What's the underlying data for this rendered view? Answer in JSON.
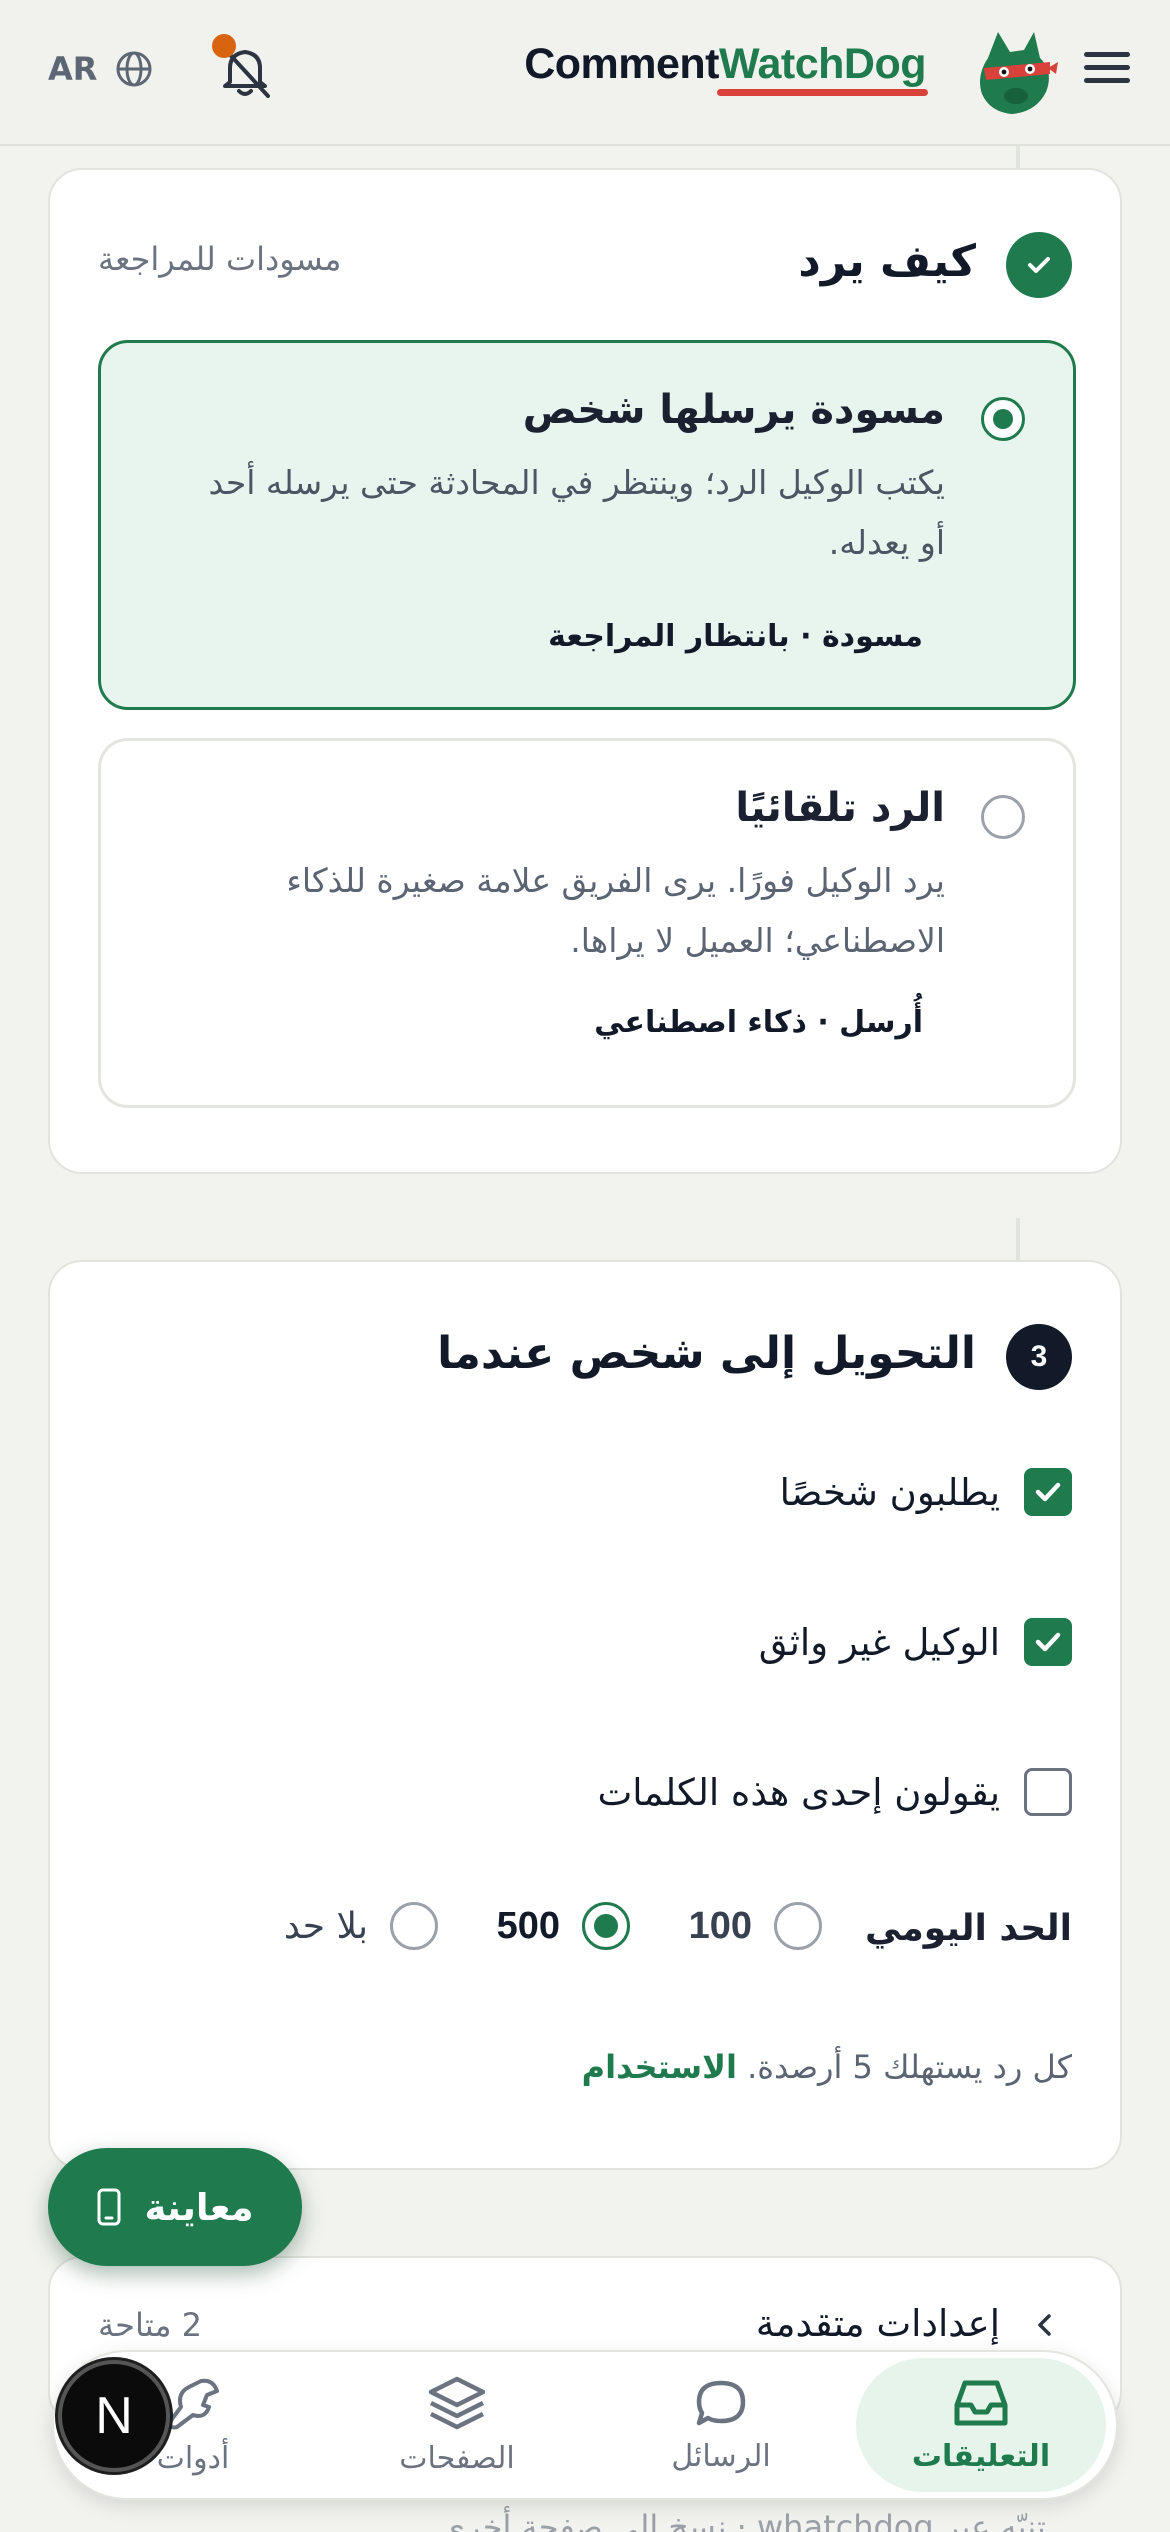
{
  "header": {
    "brand_part1": "Comment",
    "brand_part2": "WatchDog",
    "lang_label": "AR",
    "notification_dot_color": "#d9640f",
    "menu_icon": "hamburger-icon",
    "lang_icon": "globe-icon",
    "bell_icon": "bell-off-icon"
  },
  "section_reply": {
    "title": "كيف يرد",
    "aside": "مسودات للمراجعة",
    "options": [
      {
        "title": "مسودة يرسلها شخص",
        "description": "يكتب الوكيل الرد؛ وينتظر في المحادثة حتى يرسله أحد أو يعدله.",
        "tag": "مسودة · بانتظار المراجعة",
        "selected": true
      },
      {
        "title": "الرد تلقائيًا",
        "description": "يرد الوكيل فورًا. يرى الفريق علامة صغيرة للذكاء الاصطناعي؛ العميل لا يراها.",
        "tag": "أُرسل · ذكاء اصطناعي",
        "selected": false
      }
    ]
  },
  "section_handoff": {
    "step_number": "3",
    "title": "التحويل إلى شخص عندما",
    "checks": [
      {
        "label": "يطلبون شخصًا",
        "checked": true
      },
      {
        "label": "الوكيل غير واثق",
        "checked": true
      },
      {
        "label": "يقولون إحدى هذه الكلمات",
        "checked": false
      }
    ],
    "daily_limit": {
      "label": "الحد اليومي",
      "options": [
        "100",
        "500",
        "بلا حد"
      ],
      "selected": "500"
    },
    "usage_note": "كل رد يستهلك 5 أرصدة.",
    "usage_link": "الاستخدام"
  },
  "advanced": {
    "title": "إعدادات متقدمة",
    "count": "2 متاحة"
  },
  "preview_button": {
    "label": "معاينة",
    "icon": "phone-icon"
  },
  "footer_text": "تنبّه عبر whatchdog · نسخ إلى صفحة أخرى",
  "bottom_nav": [
    {
      "label": "التعليقات",
      "icon": "inbox-icon",
      "active": true
    },
    {
      "label": "الرسائل",
      "icon": "chat-bubble-icon",
      "active": false
    },
    {
      "label": "الصفحات",
      "icon": "layers-icon",
      "active": false
    },
    {
      "label": "أدوات",
      "icon": "wrench-icon",
      "active": false
    }
  ],
  "dev_badge": "N",
  "colors": {
    "accent": "#1f7a4d",
    "accent_light": "#e8f5ee",
    "brand_underline": "#d8423a",
    "dark": "#121a2a"
  }
}
